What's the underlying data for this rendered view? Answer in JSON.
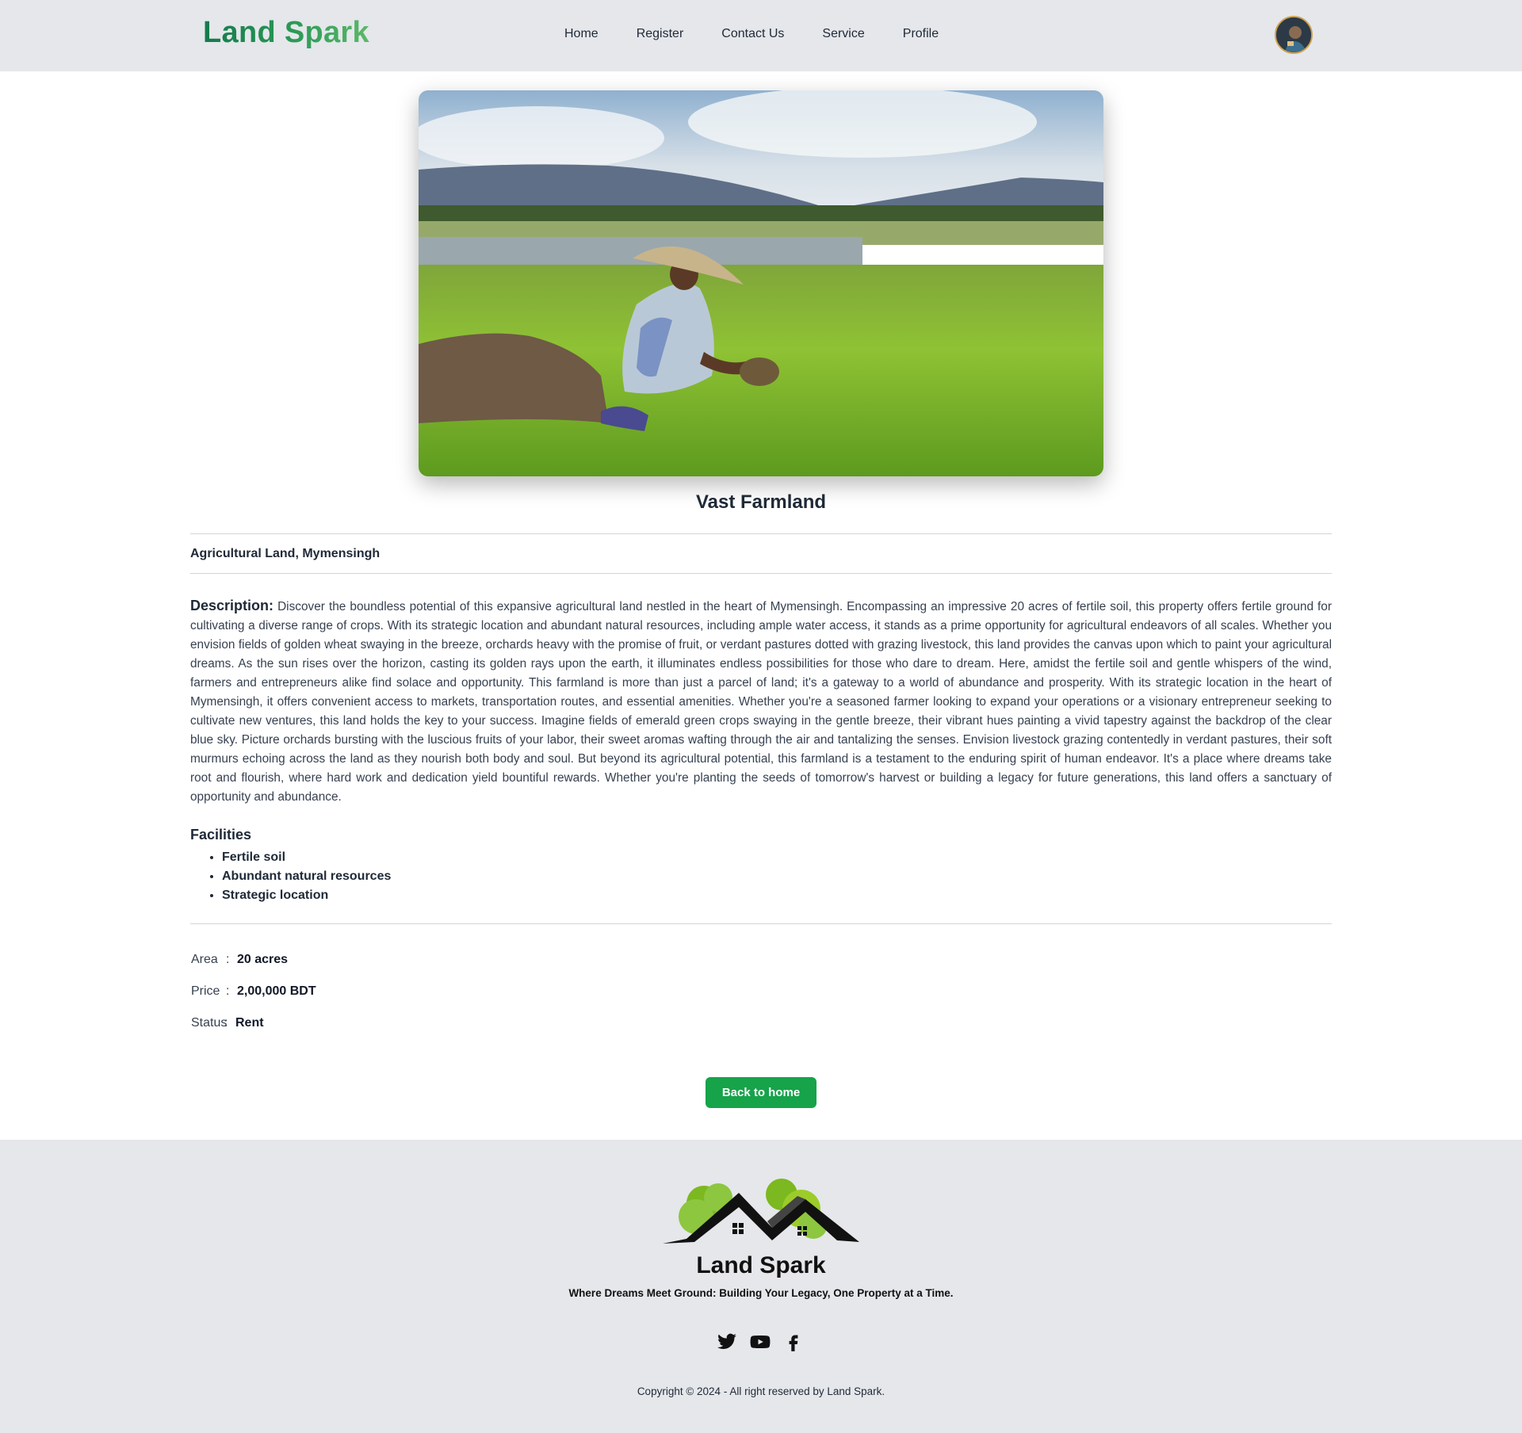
{
  "nav": {
    "brand": "Land Spark",
    "links": [
      "Home",
      "Register",
      "Contact Us",
      "Service",
      "Profile"
    ]
  },
  "property": {
    "title": "Vast Farmland",
    "location": "Agricultural Land, Mymensingh",
    "description_label": "Description:",
    "description": "Discover the boundless potential of this expansive agricultural land nestled in the heart of Mymensingh. Encompassing an impressive 20 acres of fertile soil, this property offers fertile ground for cultivating a diverse range of crops. With its strategic location and abundant natural resources, including ample water access, it stands as a prime opportunity for agricultural endeavors of all scales. Whether you envision fields of golden wheat swaying in the breeze, orchards heavy with the promise of fruit, or verdant pastures dotted with grazing livestock, this land provides the canvas upon which to paint your agricultural dreams. As the sun rises over the horizon, casting its golden rays upon the earth, it illuminates endless possibilities for those who dare to dream. Here, amidst the fertile soil and gentle whispers of the wind, farmers and entrepreneurs alike find solace and opportunity. This farmland is more than just a parcel of land; it's a gateway to a world of abundance and prosperity. With its strategic location in the heart of Mymensingh, it offers convenient access to markets, transportation routes, and essential amenities. Whether you're a seasoned farmer looking to expand your operations or a visionary entrepreneur seeking to cultivate new ventures, this land holds the key to your success. Imagine fields of emerald green crops swaying in the gentle breeze, their vibrant hues painting a vivid tapestry against the backdrop of the clear blue sky. Picture orchards bursting with the luscious fruits of your labor, their sweet aromas wafting through the air and tantalizing the senses. Envision livestock grazing contentedly in verdant pastures, their soft murmurs echoing across the land as they nourish both body and soul. But beyond its agricultural potential, this farmland is a testament to the enduring spirit of human endeavor. It's a place where dreams take root and flourish, where hard work and dedication yield bountiful rewards. Whether you're planting the seeds of tomorrow's harvest or building a legacy for future generations, this land offers a sanctuary of opportunity and abundance.",
    "facilities_title": "Facilities",
    "facilities": [
      "Fertile soil",
      "Abundant natural resources",
      "Strategic location"
    ],
    "area_label": "Area",
    "area": "20 acres",
    "price_label": "Price",
    "price": "2,00,000 BDT",
    "status_label": "Status",
    "status": "Rent",
    "separator": ":"
  },
  "actions": {
    "back_label": "Back to home"
  },
  "footer": {
    "name": "Land Spark",
    "tagline": "Where Dreams Meet Ground: Building Your Legacy, One Property at a Time.",
    "socials": [
      "twitter-icon",
      "youtube-icon",
      "facebook-icon"
    ],
    "copyright": "Copyright © 2024 - All right reserved by Land Spark."
  },
  "colors": {
    "nav_bg": "#e5e7eb",
    "brand_green": "#137a4c",
    "button_green": "#16a34a",
    "footer_bg": "#e5e7eb"
  }
}
